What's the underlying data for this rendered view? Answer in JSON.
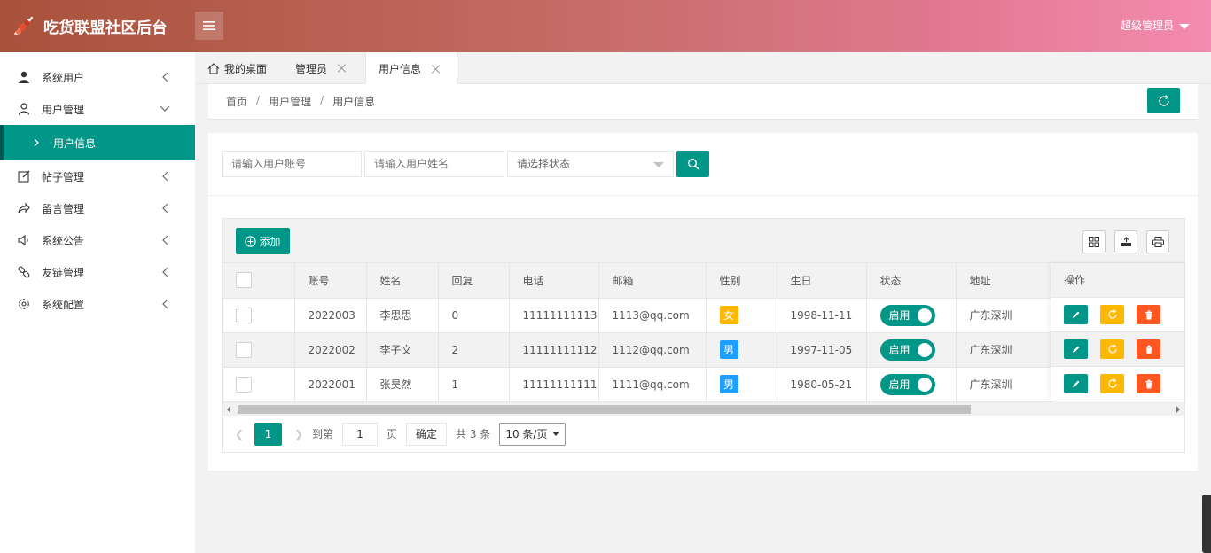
{
  "header": {
    "title": "吃货联盟社区后台",
    "user": "超级管理员"
  },
  "sidebar": {
    "items": [
      {
        "label": "系统用户",
        "icon": "user-solid-icon"
      },
      {
        "label": "用户管理",
        "icon": "user-outline-icon"
      },
      {
        "label": "帖子管理",
        "icon": "edit-icon"
      },
      {
        "label": "留言管理",
        "icon": "share-icon"
      },
      {
        "label": "系统公告",
        "icon": "speaker-icon"
      },
      {
        "label": "友链管理",
        "icon": "link-icon"
      },
      {
        "label": "系统配置",
        "icon": "gear-icon"
      }
    ],
    "sub_item": "用户信息"
  },
  "tabs": [
    {
      "label": "我的桌面"
    },
    {
      "label": "管理员"
    },
    {
      "label": "用户信息"
    }
  ],
  "breadcrumb": {
    "home": "首页",
    "parent": "用户管理",
    "current": "用户信息",
    "sep": "/"
  },
  "search": {
    "account_placeholder": "请输入用户账号",
    "name_placeholder": "请输入用户姓名",
    "status_placeholder": "请选择状态"
  },
  "toolbar": {
    "add_label": "添加"
  },
  "table": {
    "columns": [
      "账号",
      "姓名",
      "回复",
      "电话",
      "邮箱",
      "性别",
      "生日",
      "状态",
      "地址",
      "操作"
    ],
    "rows": [
      {
        "account": "2022003",
        "name": "李思思",
        "replies": "0",
        "phone": "11111111113",
        "email": "1113@qq.com",
        "gender": "女",
        "birthday": "1998-11-11",
        "status": "启用",
        "address": "广东深圳"
      },
      {
        "account": "2022002",
        "name": "李子文",
        "replies": "2",
        "phone": "11111111112",
        "email": "1112@qq.com",
        "gender": "男",
        "birthday": "1997-11-05",
        "status": "启用",
        "address": "广东深圳"
      },
      {
        "account": "2022001",
        "name": "张昊然",
        "replies": "1",
        "phone": "11111111111",
        "email": "1111@qq.com",
        "gender": "男",
        "birthday": "1980-05-21",
        "status": "启用",
        "address": "广东深圳"
      }
    ]
  },
  "pager": {
    "current": "1",
    "goto_label": "到第",
    "goto_value": "1",
    "page_unit": "页",
    "confirm": "确定",
    "total": "共 3 条",
    "page_size": "10 条/页"
  },
  "colors": {
    "accent": "#009688",
    "female": "#ffb800",
    "male": "#1e9fff",
    "warn": "#ffb800",
    "danger": "#ff5722"
  }
}
